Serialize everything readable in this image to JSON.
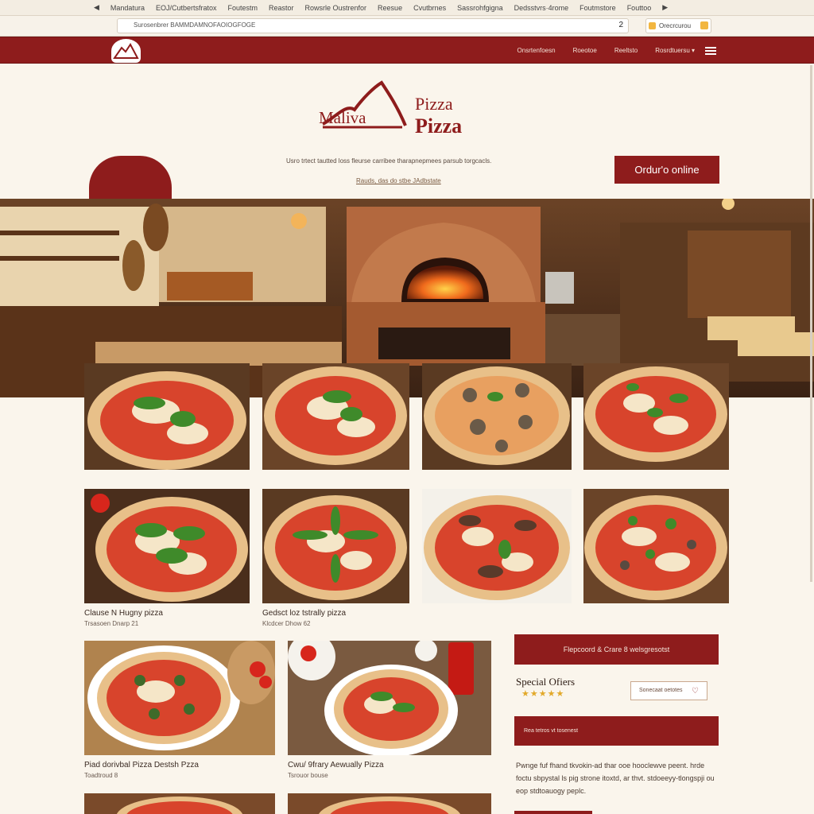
{
  "browser": {
    "tabs": [
      "Mandatura",
      "EOJ/Cutbertsfratox",
      "Foutestm",
      "Reastor",
      "Rowsrle Oustrenfor",
      "Reesue",
      "Cvutbrnes",
      "Sassrohfgigna",
      "Dedsstvrs·4rome",
      "Foutmstore",
      "Fouttoo"
    ],
    "url": "Surosenbrer BAMMDAMNOFAOIOGFOGE",
    "url_count": "2",
    "action_label": "Orecrcurou"
  },
  "nav": {
    "links": [
      "Onsrtenfoesn",
      "Roeotoe",
      "Reeltsto",
      "Rosrdtuersu ▾"
    ]
  },
  "hero": {
    "brand_name": "Maliva",
    "brand_pizza_top": "Pizza",
    "brand_pizza_bottom": "Pizza",
    "tagline": "Usro trtect tautted loss fleurse carribee tharapnepmees parsub torgcacls.",
    "tagline_link": "Rauds, das do stbe JAdbstate",
    "order_button": "Ordur'o online"
  },
  "menu": {
    "captions": [
      {
        "title": "Clause N Hugny pizza",
        "sub": "Trsasoen Dnarp 21"
      },
      {
        "title": "Gedsct loz tstrally pizza",
        "sub": "Klcdcer Dhow 62"
      },
      {
        "title": "Piad dorivbal Pizza Destsh Pzza",
        "sub": "Toadtroud 8"
      },
      {
        "title": "Cwu/ 9frary Aewually Pizza",
        "sub": "Tsrouor bouse"
      }
    ]
  },
  "side": {
    "bar1": "Flepcoord & Crare 8 welsgresotst",
    "special_title": "Special Ofiers",
    "stars": "★★★★★",
    "outline_button": "Sonecaat oetotes",
    "bar2": "Rea tetros vt tosenest",
    "description": "Pwnge fuf fhand tkvokin-ad thar ooe hooclewve peent. hrde foctu sbpystal ls pig strone itoxtd, ar thvt. stdoeeyy-tlongspji ou eop stdtoauogy peplc."
  },
  "colors": {
    "brand_red": "#8e1c1c",
    "background": "#faf5ec",
    "star": "#e2a92a"
  }
}
